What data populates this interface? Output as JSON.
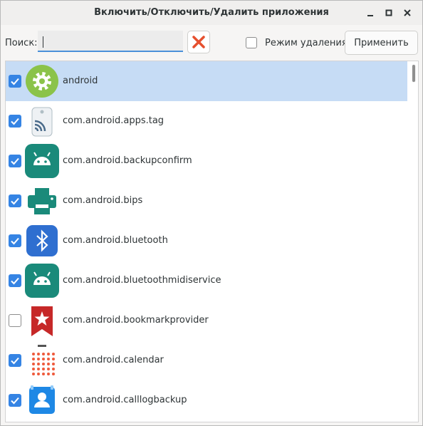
{
  "window": {
    "title": "Включить/Отключить/Удалить приложения",
    "controls": [
      "minimize-icon",
      "maximize-icon",
      "close-icon"
    ]
  },
  "toolbar": {
    "search_label": "Поиск:",
    "search_value": "",
    "clear_icon": "close-x-icon",
    "clear_color": "#e6502e",
    "delete_mode_label": "Режим удаления",
    "delete_mode_checked": false,
    "apply_label": "Применить"
  },
  "colors": {
    "accent": "#3584e4",
    "selected_row": "#c6dcf5"
  },
  "apps": [
    {
      "package": "android",
      "checked": true,
      "selected": true,
      "icon": "settings-gear-icon"
    },
    {
      "package": "com.android.apps.tag",
      "checked": true,
      "selected": false,
      "icon": "nfc-tag-icon"
    },
    {
      "package": "com.android.backupconfirm",
      "checked": true,
      "selected": false,
      "icon": "android-robot-icon"
    },
    {
      "package": "com.android.bips",
      "checked": true,
      "selected": false,
      "icon": "printer-icon"
    },
    {
      "package": "com.android.bluetooth",
      "checked": true,
      "selected": false,
      "icon": "bluetooth-icon"
    },
    {
      "package": "com.android.bluetoothmidiservice",
      "checked": true,
      "selected": false,
      "icon": "android-robot-icon"
    },
    {
      "package": "com.android.bookmarkprovider",
      "checked": false,
      "selected": false,
      "icon": "bookmark-icon"
    },
    {
      "package": "com.android.calendar",
      "checked": true,
      "selected": false,
      "icon": "calendar-icon"
    },
    {
      "package": "com.android.calllogbackup",
      "checked": true,
      "selected": false,
      "icon": "contacts-icon"
    }
  ]
}
